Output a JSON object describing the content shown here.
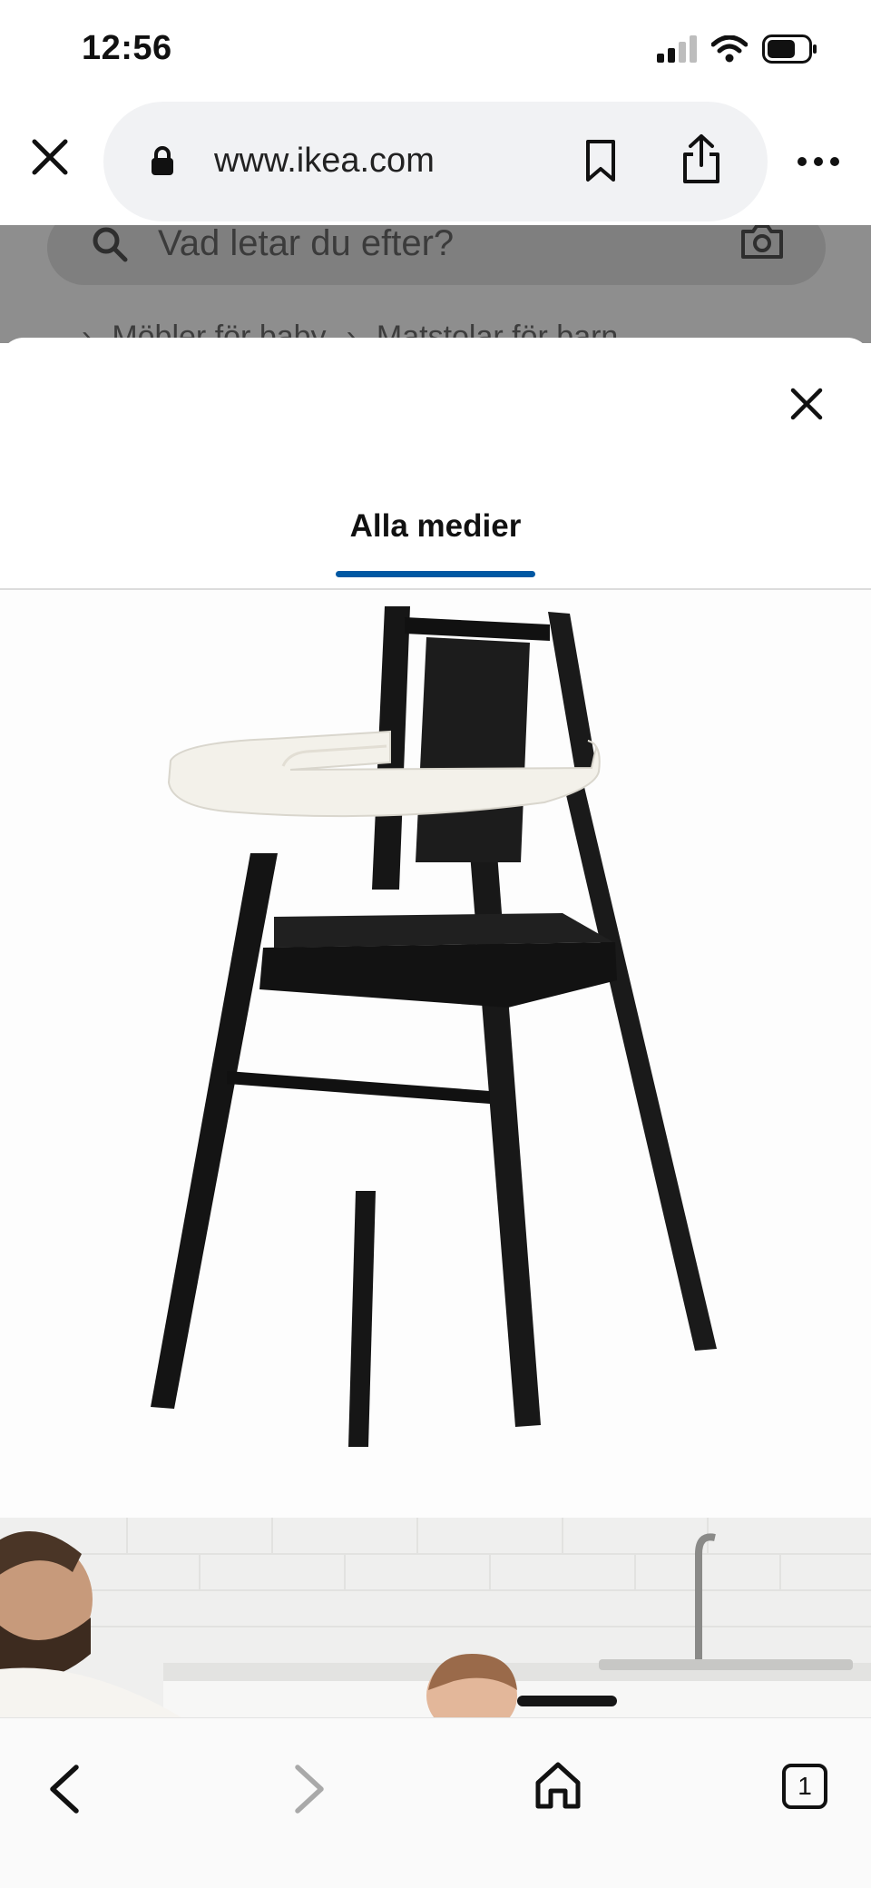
{
  "status_bar": {
    "time": "12:56"
  },
  "browser": {
    "url": "www.ikea.com"
  },
  "background_page": {
    "search_placeholder": "Vad letar du efter?",
    "breadcrumb": [
      "Möbler för baby",
      "Matstolar för barn"
    ]
  },
  "media_viewer": {
    "tabs": [
      {
        "label": "Alla medier",
        "selected": true
      }
    ]
  },
  "bottom_nav": {
    "tab_count": "1"
  },
  "colors": {
    "accent_underline": "#0058a3",
    "dim_overlay": "#8e8e8e",
    "chair_black": "#161616",
    "tray_white": "#f3f1ea"
  }
}
